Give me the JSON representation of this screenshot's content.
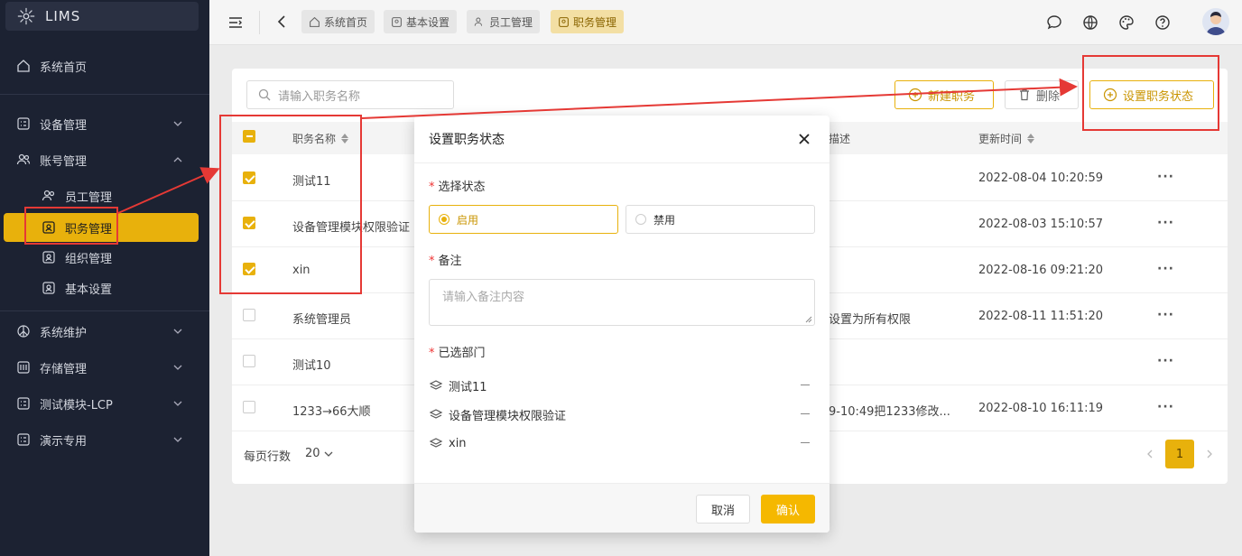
{
  "app": {
    "name": "LIMS"
  },
  "sidebar": {
    "home": "系统首页",
    "groups": [
      {
        "label": "设备管理"
      },
      {
        "label": "账号管理"
      },
      {
        "label": "系统维护"
      },
      {
        "label": "存储管理"
      },
      {
        "label": "测试模块-LCP"
      },
      {
        "label": "演示专用"
      }
    ],
    "account_items": [
      "员工管理",
      "职务管理",
      "组织管理",
      "基本设置"
    ]
  },
  "tabs": [
    "系统首页",
    "基本设置",
    "员工管理",
    "职务管理"
  ],
  "toolbar": {
    "search_placeholder": "请输入职务名称",
    "new_label": "新建职务",
    "delete_label": "删除",
    "set_status_label": "设置职务状态"
  },
  "table": {
    "headers": {
      "name": "职务名称",
      "desc": "描述",
      "updated": "更新时间"
    },
    "rows": [
      {
        "name": "测试11",
        "desc": "",
        "updated": "2022-08-04 10:20:59",
        "checked": true
      },
      {
        "name": "设备管理模块权限验证",
        "desc": "",
        "updated": "2022-08-03 15:10:57",
        "checked": true
      },
      {
        "name": "xin",
        "desc": "",
        "updated": "2022-08-16 09:21:20",
        "checked": true
      },
      {
        "name": "系统管理员",
        "desc": "设置为所有权限",
        "updated": "2022-08-11 11:51:20",
        "checked": false
      },
      {
        "name": "测试10",
        "desc": "",
        "updated": "",
        "checked": false
      },
      {
        "name": "1233→66大顺",
        "desc": "9-10:49把1233修改...",
        "updated": "2022-08-10 16:11:19",
        "checked": false
      }
    ],
    "more": "···",
    "page_size_label": "每页行数",
    "page_size": "20",
    "current_page": "1"
  },
  "modal": {
    "title": "设置职务状态",
    "status_label": "选择状态",
    "status_options": [
      "启用",
      "禁用"
    ],
    "selected_status": "启用",
    "remark_label": "备注",
    "remark_placeholder": "请输入备注内容",
    "dept_label": "已选部门",
    "depts": [
      "测试11",
      "设备管理模块权限验证",
      "xin"
    ],
    "cancel": "取消",
    "confirm": "确认"
  },
  "colors": {
    "accent": "#e8b10c",
    "sidebar_bg": "#1c2232",
    "annotation": "#e53935"
  }
}
